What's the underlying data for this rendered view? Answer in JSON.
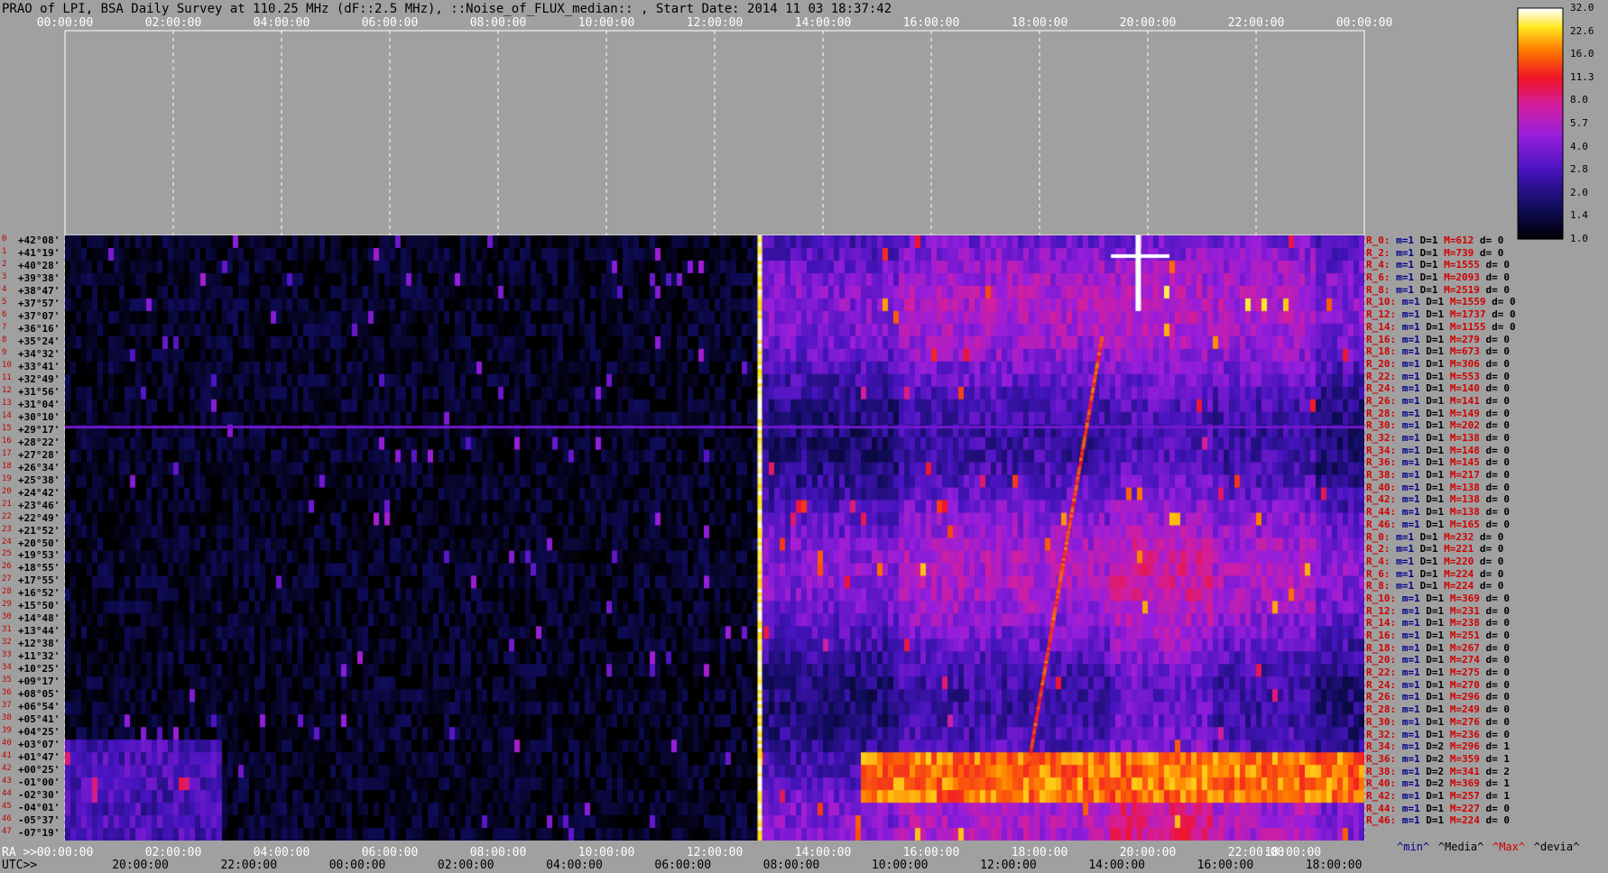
{
  "title": "PRAO of LPI, BSA Daily Survey at 110.25 MHz (dF::2.5 MHz), ::Noise_of_FLUX_median:: , Start Date: 2014 11 03 18:37:42",
  "chart_data": {
    "type": "heatmap",
    "top_axis_ticks": [
      "00:00:00",
      "02:00:00",
      "04:00:00",
      "06:00:00",
      "08:00:00",
      "10:00:00",
      "12:00:00",
      "14:00:00",
      "16:00:00",
      "18:00:00",
      "20:00:00",
      "22:00:00",
      "00:00:00"
    ],
    "ra_label": "RA >>",
    "ra_ticks": [
      "00:00:00",
      "02:00:00",
      "04:00:00",
      "06:00:00",
      "08:00:00",
      "10:00:00",
      "12:00:00",
      "14:00:00",
      "16:00:00",
      "18:00:00",
      "20:00:00",
      "22:00:00",
      "18:00:00"
    ],
    "utc_label": "UTC>>",
    "utc_ticks": [
      "20:00:00",
      "22:00:00",
      "00:00:00",
      "02:00:00",
      "04:00:00",
      "06:00:00",
      "08:00:00",
      "10:00:00",
      "12:00:00",
      "14:00:00",
      "16:00:00",
      "18:00:00"
    ],
    "dec_labels": [
      "+42°08'",
      "+41°19'",
      "+40°28'",
      "+39°38'",
      "+38°47'",
      "+37°57'",
      "+37°07'",
      "+36°16'",
      "+35°24'",
      "+34°32'",
      "+33°41'",
      "+32°49'",
      "+31°56'",
      "+31°04'",
      "+30°10'",
      "+29°17'",
      "+28°22'",
      "+27°28'",
      "+26°34'",
      "+25°38'",
      "+24°42'",
      "+23°46'",
      "+22°49'",
      "+21°52'",
      "+20°50'",
      "+19°53'",
      "+18°55'",
      "+17°55'",
      "+16°52'",
      "+15°50'",
      "+14°48'",
      "+13°44'",
      "+12°38'",
      "+11°32'",
      "+10°25'",
      "+09°17'",
      "+08°05'",
      "+06°54'",
      "+05°41'",
      "+04°25'",
      "+03°07'",
      "+01°47'",
      "+00°25'",
      "-01°00'",
      "-02°30'",
      "-04°01'",
      "-05°37'",
      "-07°19'"
    ],
    "row_indices": [
      "0",
      "1",
      "2",
      "3",
      "4",
      "5",
      "6",
      "7",
      "8",
      "9",
      "10",
      "11",
      "12",
      "13",
      "14",
      "15",
      "16",
      "17",
      "18",
      "19",
      "20",
      "21",
      "22",
      "23",
      "24",
      "25",
      "26",
      "27",
      "28",
      "29",
      "30",
      "31",
      "32",
      "33",
      "34",
      "35",
      "36",
      "37",
      "38",
      "39",
      "40",
      "41",
      "42",
      "43",
      "44",
      "45",
      "46",
      "47"
    ],
    "stats": [
      {
        "r": "R_0:",
        "min": "1",
        "dev1": "1",
        "max": "612",
        "d": "0"
      },
      {
        "r": "R_2:",
        "min": "1",
        "dev1": "1",
        "max": "739",
        "d": "0"
      },
      {
        "r": "R_4:",
        "min": "1",
        "dev1": "1",
        "max": "1555",
        "d": "0"
      },
      {
        "r": "R_6:",
        "min": "1",
        "dev1": "1",
        "max": "2093",
        "d": "0"
      },
      {
        "r": "R_8:",
        "min": "1",
        "dev1": "1",
        "max": "2519",
        "d": "0"
      },
      {
        "r": "R_10:",
        "min": "1",
        "dev1": "1",
        "max": "1559",
        "d": "0"
      },
      {
        "r": "R_12:",
        "min": "1",
        "dev1": "1",
        "max": "1737",
        "d": "0"
      },
      {
        "r": "R_14:",
        "min": "1",
        "dev1": "1",
        "max": "1155",
        "d": "0"
      },
      {
        "r": "R_16:",
        "min": "1",
        "dev1": "1",
        "max": "279",
        "d": "0"
      },
      {
        "r": "R_18:",
        "min": "1",
        "dev1": "1",
        "max": "673",
        "d": "0"
      },
      {
        "r": "R_20:",
        "min": "1",
        "dev1": "1",
        "max": "306",
        "d": "0"
      },
      {
        "r": "R_22:",
        "min": "1",
        "dev1": "1",
        "max": "553",
        "d": "0"
      },
      {
        "r": "R_24:",
        "min": "1",
        "dev1": "1",
        "max": "140",
        "d": "0"
      },
      {
        "r": "R_26:",
        "min": "1",
        "dev1": "1",
        "max": "141",
        "d": "0"
      },
      {
        "r": "R_28:",
        "min": "1",
        "dev1": "1",
        "max": "149",
        "d": "0"
      },
      {
        "r": "R_30:",
        "min": "1",
        "dev1": "1",
        "max": "202",
        "d": "0"
      },
      {
        "r": "R_32:",
        "min": "1",
        "dev1": "1",
        "max": "138",
        "d": "0"
      },
      {
        "r": "R_34:",
        "min": "1",
        "dev1": "1",
        "max": "148",
        "d": "0"
      },
      {
        "r": "R_36:",
        "min": "1",
        "dev1": "1",
        "max": "145",
        "d": "0"
      },
      {
        "r": "R_38:",
        "min": "1",
        "dev1": "1",
        "max": "217",
        "d": "0"
      },
      {
        "r": "R_40:",
        "min": "1",
        "dev1": "1",
        "max": "138",
        "d": "0"
      },
      {
        "r": "R_42:",
        "min": "1",
        "dev1": "1",
        "max": "138",
        "d": "0"
      },
      {
        "r": "R_44:",
        "min": "1",
        "dev1": "1",
        "max": "138",
        "d": "0"
      },
      {
        "r": "R_46:",
        "min": "1",
        "dev1": "1",
        "max": "165",
        "d": "0"
      },
      {
        "r": "R_0:",
        "min": "1",
        "dev1": "1",
        "max": "232",
        "d": "0"
      },
      {
        "r": "R_2:",
        "min": "1",
        "dev1": "1",
        "max": "221",
        "d": "0"
      },
      {
        "r": "R_4:",
        "min": "1",
        "dev1": "1",
        "max": "220",
        "d": "0"
      },
      {
        "r": "R_6:",
        "min": "1",
        "dev1": "1",
        "max": "224",
        "d": "0"
      },
      {
        "r": "R_8:",
        "min": "1",
        "dev1": "1",
        "max": "224",
        "d": "0"
      },
      {
        "r": "R_10:",
        "min": "1",
        "dev1": "1",
        "max": "369",
        "d": "0"
      },
      {
        "r": "R_12:",
        "min": "1",
        "dev1": "1",
        "max": "231",
        "d": "0"
      },
      {
        "r": "R_14:",
        "min": "1",
        "dev1": "1",
        "max": "238",
        "d": "0"
      },
      {
        "r": "R_16:",
        "min": "1",
        "dev1": "1",
        "max": "251",
        "d": "0"
      },
      {
        "r": "R_18:",
        "min": "1",
        "dev1": "1",
        "max": "267",
        "d": "0"
      },
      {
        "r": "R_20:",
        "min": "1",
        "dev1": "1",
        "max": "274",
        "d": "0"
      },
      {
        "r": "R_22:",
        "min": "1",
        "dev1": "1",
        "max": "275",
        "d": "0"
      },
      {
        "r": "R_24:",
        "min": "1",
        "dev1": "1",
        "max": "270",
        "d": "0"
      },
      {
        "r": "R_26:",
        "min": "1",
        "dev1": "1",
        "max": "296",
        "d": "0"
      },
      {
        "r": "R_28:",
        "min": "1",
        "dev1": "1",
        "max": "249",
        "d": "0"
      },
      {
        "r": "R_30:",
        "min": "1",
        "dev1": "1",
        "max": "276",
        "d": "0"
      },
      {
        "r": "R_32:",
        "min": "1",
        "dev1": "1",
        "max": "236",
        "d": "0"
      },
      {
        "r": "R_34:",
        "min": "1",
        "dev1": "2",
        "max": "296",
        "d": "1"
      },
      {
        "r": "R_36:",
        "min": "1",
        "dev1": "2",
        "max": "359",
        "d": "1"
      },
      {
        "r": "R_38:",
        "min": "1",
        "dev1": "2",
        "max": "341",
        "d": "2"
      },
      {
        "r": "R_40:",
        "min": "1",
        "dev1": "2",
        "max": "369",
        "d": "1"
      },
      {
        "r": "R_42:",
        "min": "1",
        "dev1": "1",
        "max": "257",
        "d": "1"
      },
      {
        "r": "R_44:",
        "min": "1",
        "dev1": "1",
        "max": "227",
        "d": "0"
      },
      {
        "r": "R_46:",
        "min": "1",
        "dev1": "1",
        "max": "224",
        "d": "0"
      }
    ],
    "stat_keys": {
      "m": "m=",
      "D": "D=",
      "M": "M=",
      "d": "d="
    },
    "legend_keys": [
      "^min^",
      "^Media^",
      "^Max^",
      "^devia^"
    ],
    "colorbar": {
      "labels": [
        "32.0",
        "22.6",
        "16.0",
        "11.3",
        "8.0",
        "5.7",
        "4.0",
        "2.8",
        "2.0",
        "1.4",
        "1.0"
      ],
      "range": [
        1.0,
        32.0
      ],
      "scale": "log"
    },
    "colors": {
      "min": "#00008b",
      "max": "#d00000",
      "background": "#a0a0a0"
    }
  }
}
